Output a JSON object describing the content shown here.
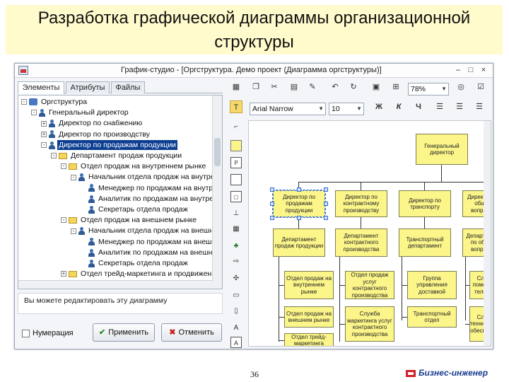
{
  "slide": {
    "title": "Разработка графической диаграммы организационной структуры",
    "page_number": "36",
    "logo_text": "Бизнес-инженер"
  },
  "window": {
    "title": "График-студио - [Оргструктура. Демо проект (Диаграмма оргструктуры)]",
    "controls": [
      "–",
      "□",
      "×"
    ]
  },
  "left_panel": {
    "tabs": [
      {
        "label": "Элементы"
      },
      {
        "label": "Атрибуты"
      },
      {
        "label": "Файлы"
      }
    ],
    "tree": [
      {
        "label": "Оргструктура",
        "icon": "org-folder-icon",
        "level": 0,
        "expander": "-"
      },
      {
        "label": "Генеральный директор",
        "icon": "person-icon",
        "level": 1,
        "expander": "-"
      },
      {
        "label": "Директор по снабжению",
        "icon": "person-icon",
        "level": 2,
        "expander": "+"
      },
      {
        "label": "Директор по производству",
        "icon": "person-icon",
        "level": 2,
        "expander": "+"
      },
      {
        "label": "Директор по продажам продукции",
        "icon": "person-icon",
        "level": 2,
        "expander": "-",
        "selected": true
      },
      {
        "label": "Департамент продаж продукции",
        "icon": "folder-icon",
        "level": 3,
        "expander": "-"
      },
      {
        "label": "Отдел продаж на внутреннем рынке",
        "icon": "folder-icon",
        "level": 4,
        "expander": "-"
      },
      {
        "label": "Начальник отдела продаж на внутреннем рынке",
        "icon": "person-icon",
        "level": 5,
        "expander": "-"
      },
      {
        "label": "Менеджер по продажам на внутреннем рынке",
        "icon": "person-icon",
        "level": 6,
        "expander": ""
      },
      {
        "label": "Аналитик по продажам на внутреннем рынке",
        "icon": "person-icon",
        "level": 6,
        "expander": ""
      },
      {
        "label": "Секретарь отдела продаж",
        "icon": "person-icon",
        "level": 6,
        "expander": ""
      },
      {
        "label": "Отдел продаж на внешнем рынке",
        "icon": "folder-icon",
        "level": 4,
        "expander": "-"
      },
      {
        "label": "Начальник отдела продаж на внешнем рынке",
        "icon": "person-icon",
        "level": 5,
        "expander": "-"
      },
      {
        "label": "Менеджер по продажам на внешнем рынке",
        "icon": "person-icon",
        "level": 6,
        "expander": ""
      },
      {
        "label": "Аналитик по продажам на внешнем рынке",
        "icon": "person-icon",
        "level": 6,
        "expander": ""
      },
      {
        "label": "Секретарь отдела продаж",
        "icon": "person-icon",
        "level": 6,
        "expander": ""
      },
      {
        "label": "Отдел трейд-маркетинга и продвижения",
        "icon": "folder-icon",
        "level": 4,
        "expander": "+"
      }
    ],
    "hint": "Вы можете редактировать эту диаграмму",
    "numbering_label": "Нумерация",
    "apply_label": "Применить",
    "cancel_label": "Отменить"
  },
  "toolbar": {
    "zoom": "78%",
    "font_name": "Arial Narrow",
    "font_size": "10",
    "bold": "Ж",
    "italic": "К",
    "underline": "Ч"
  },
  "diagram": {
    "nodes": [
      {
        "id": "ceo",
        "label": "Генеральный директор"
      },
      {
        "id": "d1",
        "label": "Директор по продажам продукции"
      },
      {
        "id": "d2",
        "label": "Директор по контрактному производству"
      },
      {
        "id": "d3",
        "label": "Директор по транспорту"
      },
      {
        "id": "d4",
        "label": "Директор по общим вопросам"
      },
      {
        "id": "dep1",
        "label": "Департамент продаж продукции"
      },
      {
        "id": "dep2",
        "label": "Департамент контрактного производства"
      },
      {
        "id": "dep3",
        "label": "Транспортный департамент"
      },
      {
        "id": "dep4",
        "label": "Департамент по общим вопросам"
      },
      {
        "id": "o11",
        "label": "Отдел продаж на внутреннем рынке"
      },
      {
        "id": "o12",
        "label": "Отдел продаж на внешнем рынке"
      },
      {
        "id": "o13",
        "label": "Отдел трейд-маркетинга"
      },
      {
        "id": "o21",
        "label": "Отдел продаж услуг контрактного производства"
      },
      {
        "id": "o22",
        "label": "Служба маркетинга услуг контрактного производства"
      },
      {
        "id": "o31",
        "label": "Группа управления доставкой"
      },
      {
        "id": "o32",
        "label": "Транспортный отдел"
      },
      {
        "id": "o41",
        "label": "Служба помощи по телефону"
      },
      {
        "id": "o42",
        "label": "Служба технического обеспечения"
      }
    ]
  },
  "colors": {
    "title_bg": "#fffbcc",
    "node_fill": "#fbf58a",
    "selection": "#0b3d91"
  }
}
